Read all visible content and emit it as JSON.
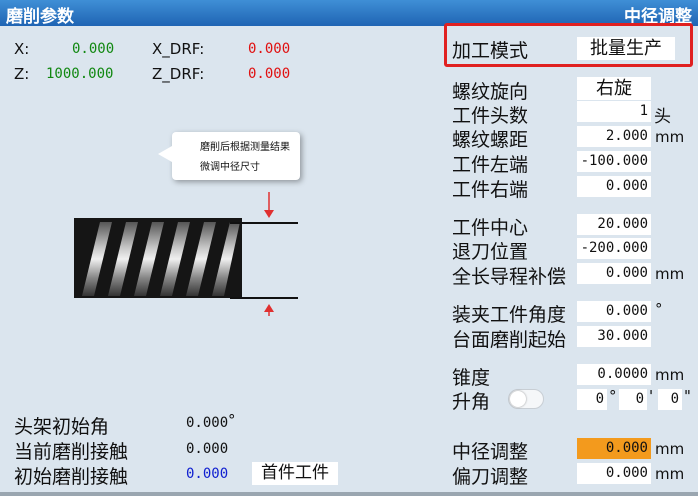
{
  "title": "磨削参数",
  "mode_title": "中径调整",
  "drf": {
    "x_label": "X:",
    "x_value": "0.000",
    "xdrf_label": "X_DRF:",
    "xdrf_value": "0.000",
    "z_label": "Z:",
    "z_value": "1000.000",
    "zdrf_label": "Z_DRF:",
    "zdrf_value": "0.000"
  },
  "callout": {
    "line1": "磨削后根据测量结果",
    "line2": "微调中径尺寸"
  },
  "right": {
    "machining_mode_label": "加工模式",
    "machining_mode_value": "批量生产",
    "thread_dir_label": "螺纹旋向",
    "thread_dir_value": "右旋",
    "head_count_label": "工件头数",
    "head_count_value": "1",
    "head_count_unit": "头",
    "pitch_label": "螺纹螺距",
    "pitch_value": "2.000",
    "pitch_unit": "mm",
    "left_end_label": "工件左端",
    "left_end_value": "-100.000",
    "right_end_label": "工件右端",
    "right_end_value": "0.000",
    "center_label": "工件中心",
    "center_value": "20.000",
    "retract_label": "退刀位置",
    "retract_value": "-200.000",
    "lead_comp_label": "全长导程补偿",
    "lead_comp_value": "0.000",
    "lead_comp_unit": "mm",
    "clamp_angle_label": "装夹工件角度",
    "clamp_angle_value": "0.000",
    "clamp_angle_unit": "°",
    "table_start_label": "台面磨削起始",
    "table_start_value": "30.000",
    "taper_label": "锥度",
    "taper_value": "0.0000",
    "taper_unit": "mm",
    "lift_label": "升角",
    "lift_deg": "0",
    "lift_deg_unit": "°",
    "lift_min": "0",
    "lift_min_unit": "'",
    "lift_sec": "0",
    "lift_sec_unit": "\"",
    "pitch_adjust_label": "中径调整",
    "pitch_adjust_value": "0.000",
    "pitch_adjust_unit": "mm",
    "offset_adjust_label": "偏刀调整",
    "offset_adjust_value": "0.000",
    "offset_adjust_unit": "mm"
  },
  "bottom_left": {
    "head_angle_label": "头架初始角",
    "head_angle_value": "0.000",
    "head_angle_unit": "°",
    "current_contact_label": "当前磨削接触",
    "current_contact_value": "0.000",
    "initial_contact_label": "初始磨削接触",
    "initial_contact_value": "0.000",
    "first_part_label": "首件工件"
  },
  "colors": {
    "highlight": "#f39a1d",
    "frame": "#e02020",
    "title_bg": "#2a73c1"
  }
}
